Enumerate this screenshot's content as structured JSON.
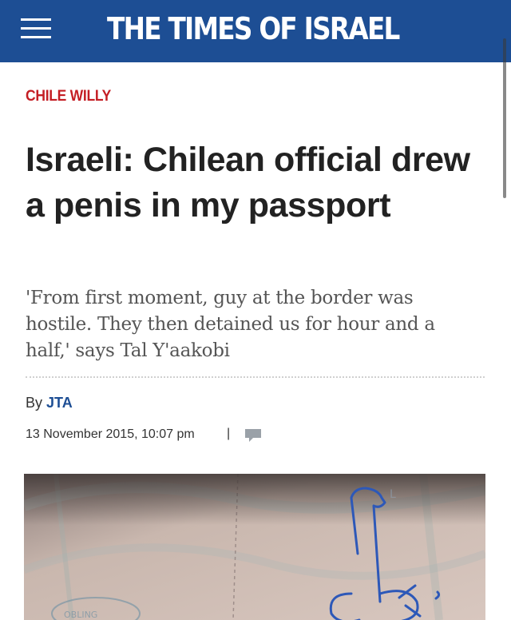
{
  "header": {
    "logo_text": "THE TIMES OF ISRAEL",
    "menu_icon": "hamburger-menu-icon",
    "background": "#1d4e94"
  },
  "article": {
    "kicker": "CHILE WILLY",
    "headline": "Israeli: Chilean official drew a penis in my passport",
    "subhead": "'From first moment, guy at the border was hostile. They then detained us for hour and a half,' says Tal Y'aakobi",
    "byline_prefix": "By",
    "author": "JTA",
    "date": "13 November 2015, 10:07 pm",
    "separator": "|",
    "comment_icon": "comment-icon"
  },
  "photo": {
    "description_icon": "passport-photo",
    "stamp_text": "OBLING"
  },
  "colors": {
    "brand": "#1d4e94",
    "kicker": "#c41e24",
    "headline": "#222222"
  }
}
